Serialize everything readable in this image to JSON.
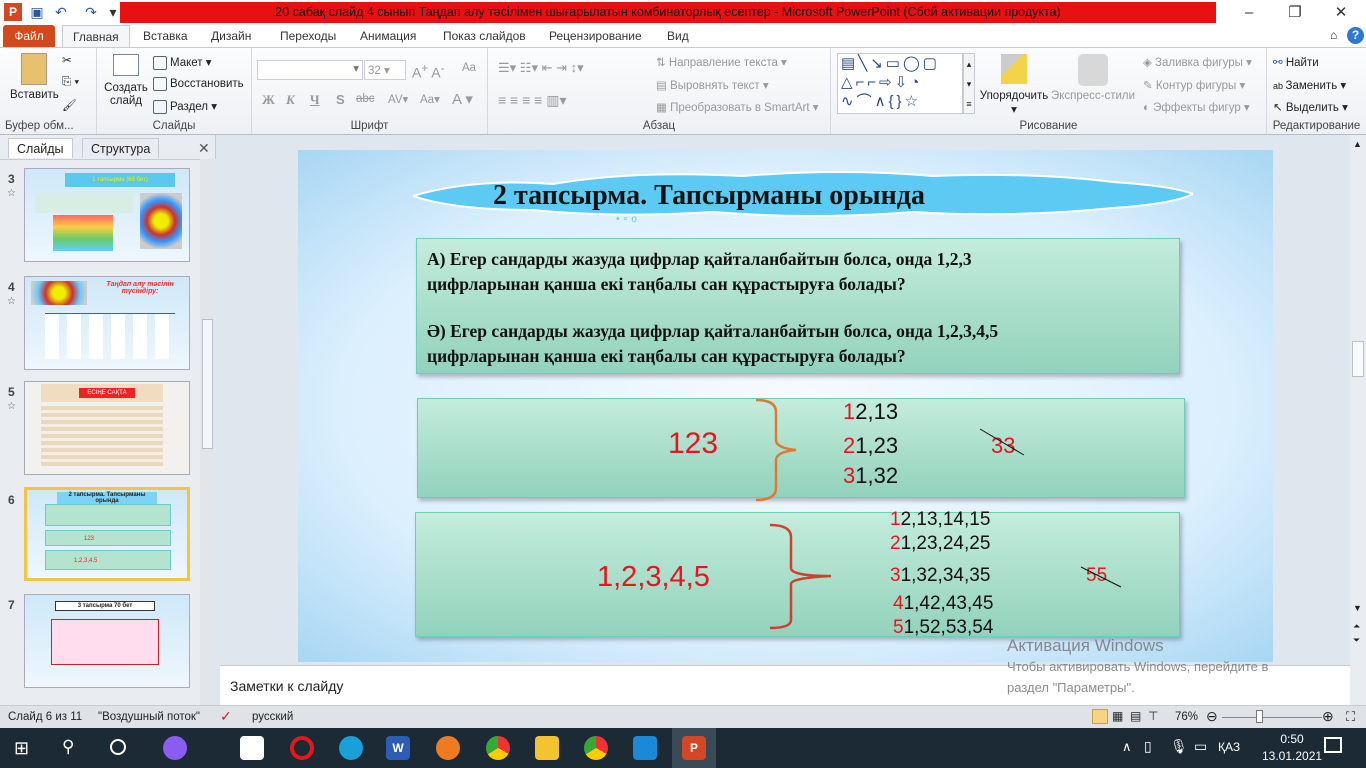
{
  "window": {
    "title": "20 сабақ слайд 4 сынып Таңдап алу тәсілімен шығарылатын комбинаторлық есептер  -  Microsoft PowerPoint (Сбой активации продукта)"
  },
  "tabs": [
    "Файл",
    "Главная",
    "Вставка",
    "Дизайн",
    "Переходы",
    "Анимация",
    "Показ слайдов",
    "Рецензирование",
    "Вид"
  ],
  "ribbon": {
    "clipboard": {
      "paste": "Вставить",
      "label": "Буфер обм..."
    },
    "slides": {
      "new_slide": "Создать слайд",
      "layout": "Макет",
      "reset": "Восстановить",
      "section": "Раздел",
      "label": "Слайды"
    },
    "font": {
      "font_size": "32",
      "bold": "Ж",
      "italic": "К",
      "underline": "Ч",
      "shadow": "S",
      "strike": "abc",
      "label": "Шрифт"
    },
    "paragraph": {
      "text_direction": "Направление текста",
      "align_text": "Выровнять текст",
      "smartart": "Преобразовать в SmartArt",
      "label": "Абзац"
    },
    "drawing": {
      "arrange": "Упорядочить",
      "quick_styles": "Экспресс-стили",
      "fill": "Заливка фигуры",
      "outline": "Контур фигуры",
      "effects": "Эффекты фигур",
      "label": "Рисование"
    },
    "editing": {
      "find": "Найти",
      "replace": "Заменить",
      "select": "Выделить",
      "label": "Редактирование"
    }
  },
  "panel": {
    "tabs": [
      "Слайды",
      "Структура"
    ],
    "slides": [
      {
        "num": "3",
        "title": "1 тапсырма       (69 бет)"
      },
      {
        "num": "4",
        "title": "Таңдап алу тәсілін түсіндіру:"
      },
      {
        "num": "5",
        "title": "ЕСІҢЕ САҚТА"
      },
      {
        "num": "6",
        "title": "2 тапсырма. Тапсырманы орында"
      },
      {
        "num": "7",
        "title": "3 тапсырма      70 бет"
      }
    ]
  },
  "slide": {
    "title": "2 тапсырма. Тапсырманы орында",
    "question_a": "А) Егер сандарды жазуда цифрлар  қайталанбайтын болса, онда 1,2,3 цифрларынан  қанша екі таңбалы сан құрастыруға  болады?",
    "question_b": "Ә) Егер сандарды жазуда цифрлар  қайталанбайтын болса, онда 1,2,3,4,5 цифрларынан  қанша екі таңбалы сан құрастыруға  болады?",
    "set_a": {
      "digits": "123",
      "rows": [
        {
          "lead": "1",
          "rest": "2,13"
        },
        {
          "lead": "2",
          "rest": "1,23"
        },
        {
          "lead": "3",
          "rest": "1,32"
        }
      ],
      "crossed": "33"
    },
    "set_b": {
      "digits": "1,2,3,4,5",
      "rows": [
        {
          "lead": "1",
          "rest": "2,13,14,15"
        },
        {
          "lead": "2",
          "rest": "1,23,24,25"
        },
        {
          "lead": "3",
          "rest": "1,32,34,35"
        },
        {
          "lead": "4",
          "rest": "1,42,43,45"
        },
        {
          "lead": "5",
          "rest": "1,52,53,54"
        }
      ],
      "crossed": "55"
    }
  },
  "notes": {
    "placeholder": "Заметки к слайду"
  },
  "watermark": {
    "line1": "Активация Windows",
    "line2": "Чтобы активировать Windows, перейдите в",
    "line3": "раздел \"Параметры\"."
  },
  "status": {
    "slide": "Слайд 6 из 11",
    "theme": "\"Воздушный поток\"",
    "language": "русский",
    "zoom": "76%"
  },
  "taskbar": {
    "lang": "ҚАЗ",
    "time": "0:50",
    "date": "13.01.2021"
  }
}
